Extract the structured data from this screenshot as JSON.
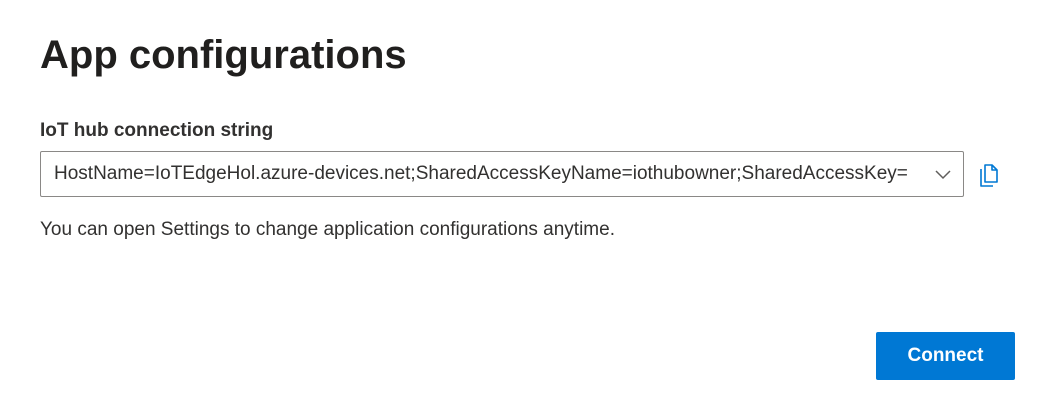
{
  "page": {
    "title": "App configurations"
  },
  "connection": {
    "label": "IoT hub connection string",
    "value": "HostName=IoTEdgeHol.azure-devices.net;SharedAccessKeyName=iothubowner;SharedAccessKey=",
    "dropdown_icon": "chevron-down-icon",
    "copy_icon": "copy-icon"
  },
  "help": {
    "text": "You can open Settings to change application configurations anytime."
  },
  "actions": {
    "connect_label": "Connect"
  },
  "colors": {
    "accent": "#0078d4",
    "text": "#201f1e",
    "border": "#8a8886",
    "background": "#ffffff"
  }
}
